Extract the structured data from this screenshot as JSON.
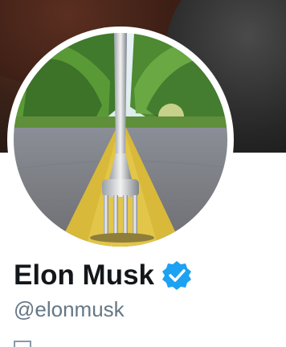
{
  "profile": {
    "name": "Elon Musk",
    "handle": "@elonmusk",
    "verified": true,
    "verified_color": "#1da1f2"
  },
  "banner": {
    "icon": "planet-banner-image"
  },
  "avatar": {
    "icon": "fork-on-road-photo"
  }
}
